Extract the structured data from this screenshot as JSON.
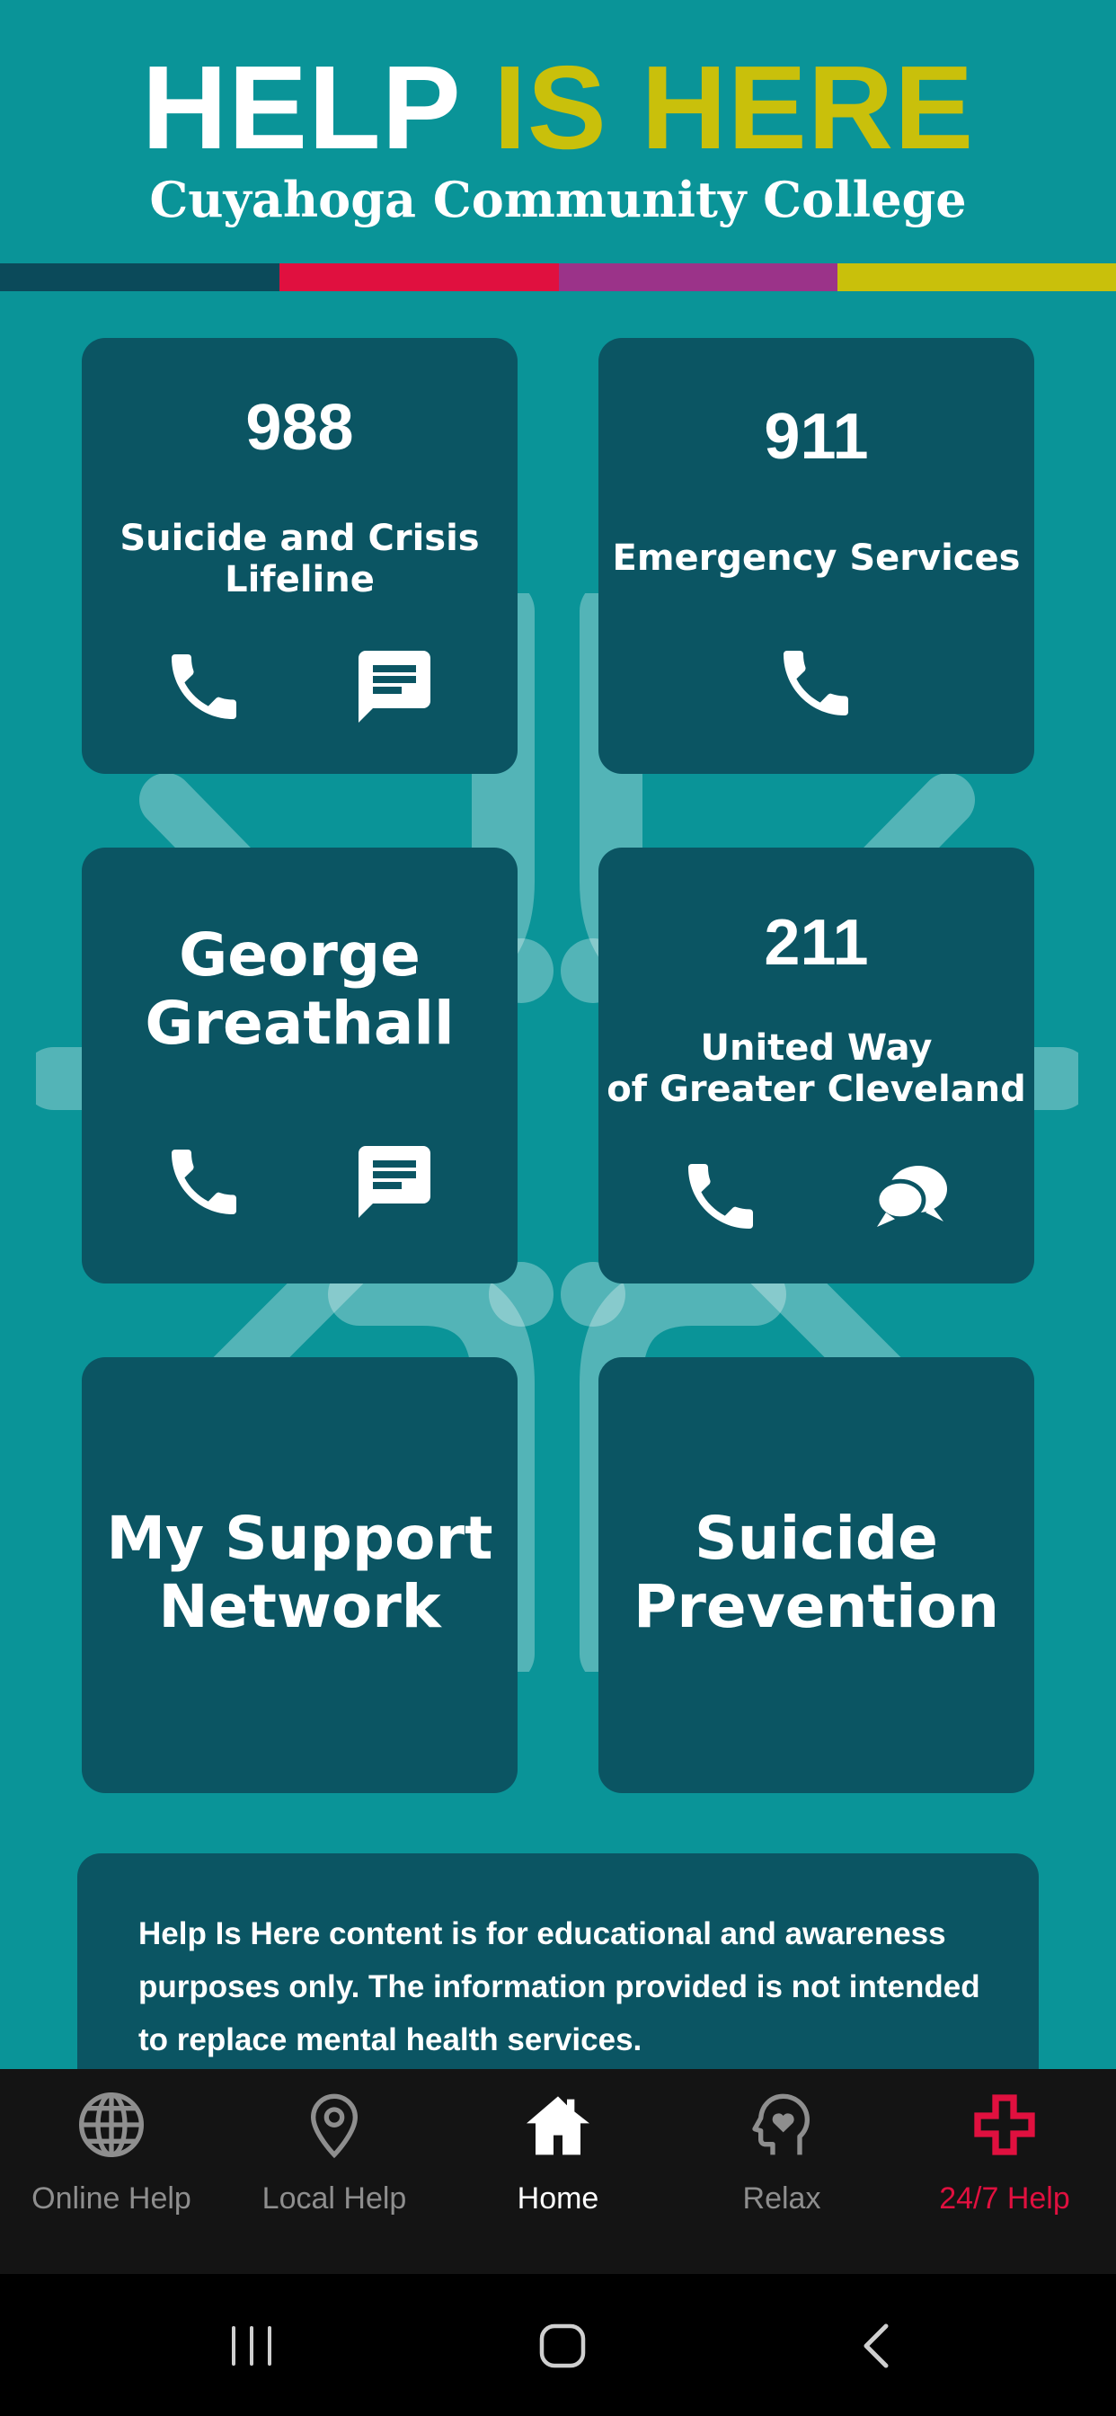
{
  "header": {
    "title_part1": "HELP",
    "title_part2": "IS HERE",
    "subtitle": "Cuyahoga Community College",
    "colors": {
      "background": "#0a9498",
      "title_white": "#ffffff",
      "title_yellow": "#c9c00b",
      "stripe": [
        "#0b4a5a",
        "#e0103f",
        "#9b3389",
        "#c9c00b"
      ]
    }
  },
  "cards": {
    "lifeline": {
      "number": "988",
      "label": "Suicide and Crisis\nLifeline",
      "icons": [
        "phone-icon",
        "message-icon"
      ]
    },
    "emergency": {
      "number": "911",
      "label": "Emergency Services",
      "icons": [
        "phone-icon"
      ]
    },
    "counselor": {
      "name": "George\nGreathall",
      "icons": [
        "phone-icon",
        "message-icon"
      ]
    },
    "united_way": {
      "number": "211",
      "label": "United Way\nof Greater Cleveland",
      "icons": [
        "phone-icon",
        "chat-bubbles-icon"
      ]
    },
    "support_network": {
      "label": "My Support\nNetwork"
    },
    "suicide_prevention": {
      "label": "Suicide\nPrevention"
    },
    "card_color": "#0b5563"
  },
  "disclaimer": {
    "text": "Help Is Here content is for educational and awareness purposes only. The information provided is not intended to replace mental health services."
  },
  "tabbar": {
    "items": [
      {
        "label": "Online Help",
        "icon": "globe-icon",
        "active": false
      },
      {
        "label": "Local Help",
        "icon": "map-pin-icon",
        "active": false
      },
      {
        "label": "Home",
        "icon": "home-icon",
        "active": true
      },
      {
        "label": "Relax",
        "icon": "head-heart-icon",
        "active": false
      },
      {
        "label": "24/7 Help",
        "icon": "cross-plus-icon",
        "active": false
      }
    ],
    "colors": {
      "inactive": "#8e8e8e",
      "active": "#ffffff",
      "emergency": "#e0103f",
      "background": "#141414"
    }
  },
  "system_nav": {
    "buttons": [
      "recent-apps-icon",
      "home-circle-icon",
      "back-icon"
    ]
  }
}
